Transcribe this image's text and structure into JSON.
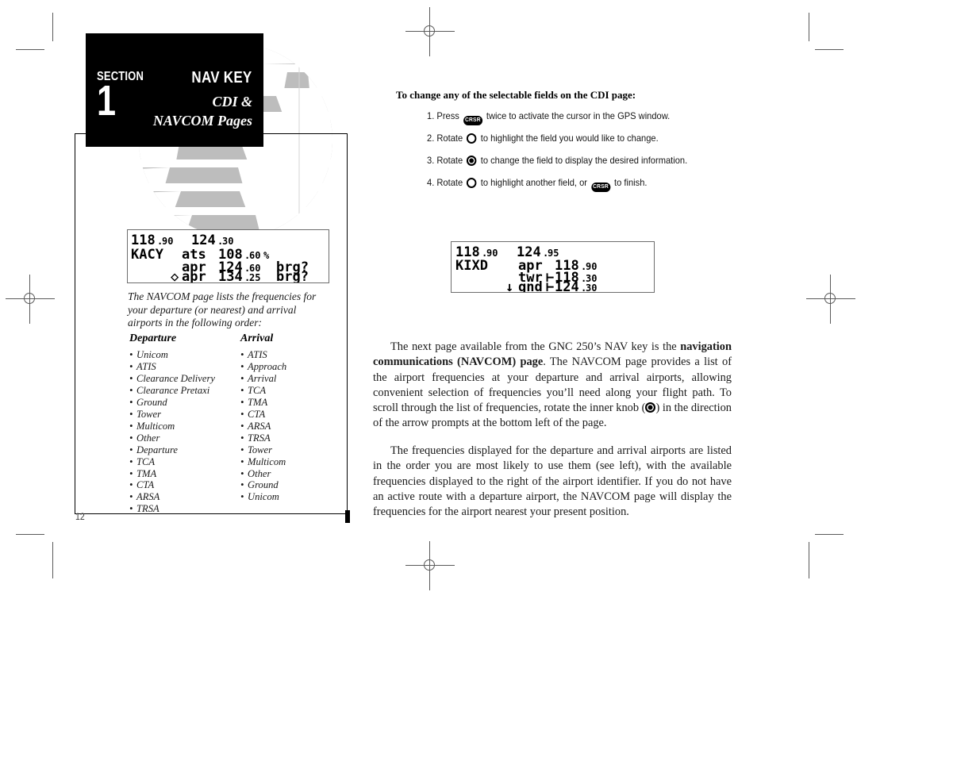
{
  "section": {
    "label": "SECTION",
    "number": "1",
    "title": "NAV KEY",
    "subtitle_line1": "CDI &",
    "subtitle_line2": "NAVCOM Pages"
  },
  "page_number": "12",
  "lcd_left": {
    "name": "navcom-page-kacy",
    "line1_left": "118.90",
    "line1_right": "124.30",
    "line2": "KACY   ats 108.60%",
    "line3": "       apr 124.60 brg?",
    "line4": "      ◇apr 134.25 brg?",
    "rows": [
      {
        "id": "freq-row-1",
        "cells": [
          "118.90",
          "124.30"
        ]
      },
      {
        "id": "freq-row-2",
        "cells": [
          "KACY",
          "ats",
          "108.60",
          "%"
        ]
      },
      {
        "id": "freq-row-3",
        "cells": [
          "",
          "apr",
          "124.60",
          "brg?"
        ]
      },
      {
        "id": "freq-row-4",
        "cells": [
          "◇",
          "apr",
          "134.25",
          "brg?"
        ]
      }
    ]
  },
  "lcd_right": {
    "name": "navcom-page-kixd",
    "rows": [
      {
        "id": "freq-row-1",
        "cells": [
          "118.90",
          "124.95"
        ]
      },
      {
        "id": "freq-row-2",
        "cells": [
          "KIXD",
          "apr",
          "118.90",
          ""
        ]
      },
      {
        "id": "freq-row-3",
        "cells": [
          "",
          "twr",
          "118.30",
          "⊢"
        ]
      },
      {
        "id": "freq-row-4",
        "cells": [
          "↓",
          "gnd",
          "124.30",
          "⊢"
        ]
      }
    ]
  },
  "caption": "The NAVCOM page lists the frequencies for your departure (or nearest) and arrival airports in the following order:",
  "columns": {
    "departure_heading": "Departure",
    "arrival_heading": "Arrival",
    "departure_items": [
      "Unicom",
      "ATIS",
      "Clearance Delivery",
      "Clearance Pretaxi",
      "Ground",
      "Tower",
      "Multicom",
      "Other",
      "Departure",
      "TCA",
      "TMA",
      "CTA",
      "ARSA",
      "TRSA"
    ],
    "arrival_items": [
      "ATIS",
      "Approach",
      "Arrival",
      "TCA",
      "TMA",
      "CTA",
      "ARSA",
      "TRSA",
      "Tower",
      "Multicom",
      "Other",
      "Ground",
      "Unicom"
    ]
  },
  "procedure": {
    "heading": "To change any of the selectable fields on the CDI page:",
    "steps": [
      {
        "num": "1.",
        "pre": "Press",
        "glyph": "crsr-button",
        "post": "twice to activate the cursor in the GPS window."
      },
      {
        "num": "2.",
        "pre": "Rotate",
        "glyph": "outer-knob",
        "post": "to highlight the field you would like to change."
      },
      {
        "num": "3.",
        "pre": "Rotate",
        "glyph": "inner-knob",
        "post": "to change the field to display the desired information."
      },
      {
        "num": "4.",
        "pre": "Rotate",
        "glyph": "outer-knob",
        "post": "to highlight another field, or",
        "glyph2": "crsr-button",
        "post2": "to finish."
      }
    ],
    "crsr_label": "CRSR"
  },
  "body": {
    "para1_a": "The next page available from the GNC 250’s NAV key is the ",
    "para1_bold": "navigation communications (NAVCOM) page",
    "para1_b": ". The NAVCOM page provides a list of the airport frequencies at your departure and arrival airports, allowing convenient selection of frequencies you’ll need along your flight path. To scroll through the list of frequencies, rotate the inner knob (",
    "para1_c": ") in the direction of the arrow prompts at the bottom left of the page.",
    "para2": "The frequencies displayed for the departure and arrival airports are listed in the order you are most likely to use them (see left), with the available frequencies displayed to the right of the airport identifier. If you do not have an active route with a departure airport, the NAVCOM page will display the frequencies for the airport nearest your present position."
  },
  "colors": {
    "ink": "#1a1a1a",
    "header_bg": "#000000",
    "watermark": "#bdbdbd",
    "lcd_border": "#6d6d6d",
    "crop_mark": "#5a5a5a"
  }
}
